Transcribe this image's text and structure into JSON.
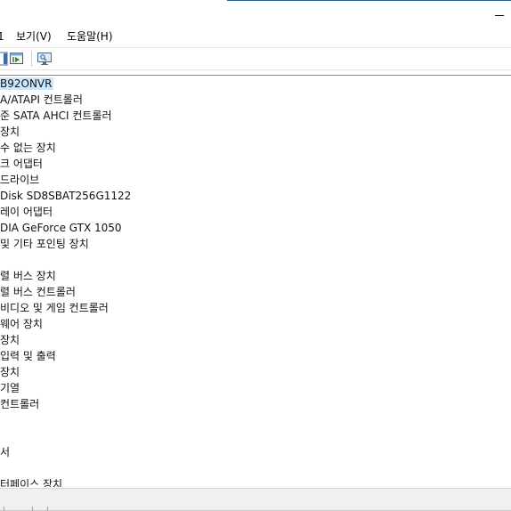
{
  "menu": {
    "partial_first": "1",
    "view_label": "보기(V)",
    "help_label": "도움말(H)"
  },
  "toolbar": {
    "icons": [
      "properties-icon",
      "update-driver-icon",
      "monitor-scan-icon"
    ]
  },
  "tree": {
    "items": [
      {
        "label": "B92ONVR",
        "selected": true
      },
      {
        "label": "A/ATAPI 컨트롤러"
      },
      {
        "label": "준 SATA AHCI 컨트롤러"
      },
      {
        "label": "장치"
      },
      {
        "label": "수 없는 장치"
      },
      {
        "label": "크 어댑터"
      },
      {
        "label": " 드라이브"
      },
      {
        "label": "Disk SD8SBAT256G1122"
      },
      {
        "label": "레이 어댑터"
      },
      {
        "label": "DIA GeForce GTX 1050"
      },
      {
        "label": " 및 기타 포인팅 장치"
      },
      {
        "label": ""
      },
      {
        "label": "렬 버스 장치"
      },
      {
        "label": "렬 버스 컨트롤러"
      },
      {
        "label": " 비디오 및 게임 컨트롤러"
      },
      {
        "label": "웨어 장치"
      },
      {
        "label": " 장치"
      },
      {
        "label": " 입력 및 출력"
      },
      {
        "label": " 장치"
      },
      {
        "label": "기열"
      },
      {
        "label": " 컨트롤러"
      },
      {
        "label": ""
      },
      {
        "label": ""
      },
      {
        "label": "서"
      },
      {
        "label": ""
      },
      {
        "label": "터페이스 장치"
      }
    ]
  },
  "colors": {
    "selection": "#cce8ff",
    "title_accent": "#2c5f8a"
  }
}
